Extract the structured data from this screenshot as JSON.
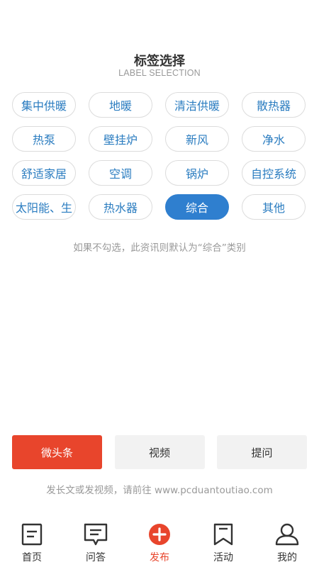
{
  "header": {
    "title": "标签选择",
    "subtitle": "LABEL SELECTION"
  },
  "tags": [
    {
      "label": "集中供暖",
      "selected": false
    },
    {
      "label": "地暖",
      "selected": false
    },
    {
      "label": "清洁供暖",
      "selected": false
    },
    {
      "label": "散热器",
      "selected": false
    },
    {
      "label": "热泵",
      "selected": false
    },
    {
      "label": "壁挂炉",
      "selected": false
    },
    {
      "label": "新风",
      "selected": false
    },
    {
      "label": "净水",
      "selected": false
    },
    {
      "label": "舒适家居",
      "selected": false
    },
    {
      "label": "空调",
      "selected": false
    },
    {
      "label": "锅炉",
      "selected": false
    },
    {
      "label": "自控系统",
      "selected": false
    },
    {
      "label": "太阳能、生",
      "selected": false
    },
    {
      "label": "热水器",
      "selected": false
    },
    {
      "label": "综合",
      "selected": true
    },
    {
      "label": "其他",
      "selected": false
    }
  ],
  "hint": "如果不勾选，此资讯则默认为“综合”类别",
  "actions": {
    "micro_headline": "微头条",
    "video": "视频",
    "ask": "提问"
  },
  "footnote": "发长文或发视频，请前往 www.pcduantoutiao.com",
  "tabbar": {
    "home": "首页",
    "qa": "问答",
    "publish": "发布",
    "activity": "活动",
    "mine": "我的"
  },
  "colors": {
    "accent_blue": "#2f7fcf",
    "accent_red": "#e8452c"
  }
}
